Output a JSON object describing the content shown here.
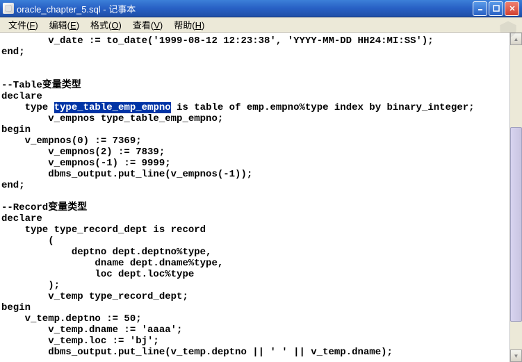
{
  "window": {
    "title": "oracle_chapter_5.sql - 记事本"
  },
  "menu": {
    "file": "文件",
    "file_key": "F",
    "edit": "编辑",
    "edit_key": "E",
    "format": "格式",
    "format_key": "O",
    "view": "查看",
    "view_key": "V",
    "help": "帮助",
    "help_key": "H"
  },
  "editor": {
    "lines": {
      "l0": "        v_date := to_date('1999-08-12 12:23:38', 'YYYY-MM-DD HH24:MI:SS');",
      "l1": "end;",
      "l2": "",
      "l3": "",
      "l4": "--Table变量类型",
      "l5": "declare",
      "l6a": "    type ",
      "l6b": "type_table_emp_empno",
      "l6c": " is table of emp.empno%type index by binary_integer;",
      "l7": "        v_empnos type_table_emp_empno;",
      "l8": "begin",
      "l9": "    v_empnos(0) := 7369;",
      "l10": "        v_empnos(2) := 7839;",
      "l11": "        v_empnos(-1) := 9999;",
      "l12": "        dbms_output.put_line(v_empnos(-1));",
      "l13": "end;",
      "l14": "",
      "l15": "--Record变量类型",
      "l16": "declare",
      "l17": "    type type_record_dept is record",
      "l18": "        (",
      "l19": "            deptno dept.deptno%type,",
      "l20": "                dname dept.dname%type,",
      "l21": "                loc dept.loc%type",
      "l22": "        );",
      "l23": "        v_temp type_record_dept;",
      "l24": "begin",
      "l25": "    v_temp.deptno := 50;",
      "l26": "        v_temp.dname := 'aaaa';",
      "l27": "        v_temp.loc := 'bj';",
      "l28": "        dbms_output.put_line(v_temp.deptno || ' ' || v_temp.dname);"
    }
  }
}
